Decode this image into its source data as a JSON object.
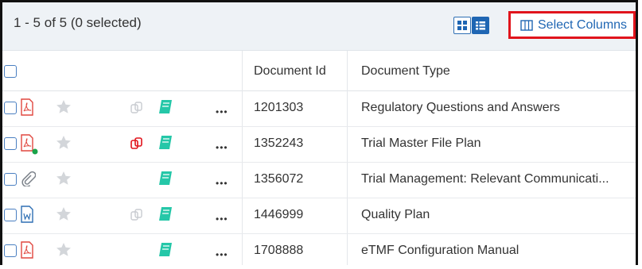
{
  "toolbar": {
    "summary": "1 - 5 of 5 (0 selected)",
    "select_columns_label": "Select Columns",
    "view_modes": [
      "grid-view",
      "list-view"
    ],
    "active_view": "list-view"
  },
  "columns": {
    "document_id": "Document Id",
    "document_type": "Document Type"
  },
  "rows": [
    {
      "file_icon": "pdf-icon",
      "comment_icon": "copies-icon",
      "copies_active": false,
      "has_green_dot": false,
      "id": "1201303",
      "type": "Regulatory Questions and Answers"
    },
    {
      "file_icon": "pdf-icon",
      "comment_icon": "copies-icon",
      "copies_active": true,
      "has_green_dot": true,
      "id": "1352243",
      "type": "Trial Master File Plan"
    },
    {
      "file_icon": "attachment-icon",
      "comment_icon": "",
      "copies_active": false,
      "has_green_dot": false,
      "id": "1356072",
      "type": "Trial Management: Relevant Communicati..."
    },
    {
      "file_icon": "word-icon",
      "comment_icon": "copies-icon",
      "copies_active": false,
      "has_green_dot": false,
      "id": "1446999",
      "type": "Quality Plan"
    },
    {
      "file_icon": "pdf-icon",
      "comment_icon": "",
      "copies_active": false,
      "has_green_dot": false,
      "id": "1708888",
      "type": "eTMF Configuration Manual"
    }
  ],
  "colors": {
    "accent": "#1f66b3",
    "highlight_border": "#e1141c",
    "pdf_red": "#e0473f",
    "teal_book": "#25c7a8",
    "star_gray": "#d3d6da",
    "status_green": "#1aa34a"
  }
}
